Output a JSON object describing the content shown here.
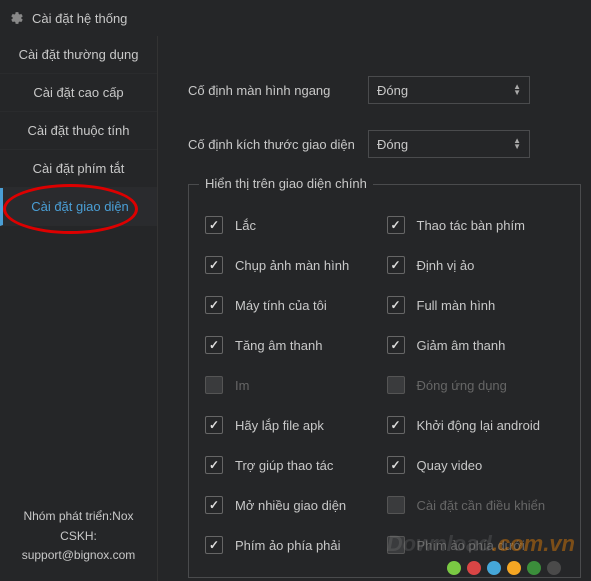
{
  "window": {
    "title": "Cài đặt hệ thống"
  },
  "sidebar": {
    "items": [
      {
        "label": "Cài đặt thường dụng"
      },
      {
        "label": "Cài đặt cao cấp"
      },
      {
        "label": "Cài đặt thuộc tính"
      },
      {
        "label": "Cài đặt phím tắt"
      },
      {
        "label": "Cài đặt giao diện"
      }
    ],
    "footer": {
      "line1": "Nhóm phát triển:Nox",
      "line2": "CSKH:",
      "line3": "support@bignox.com"
    }
  },
  "dropdowns": [
    {
      "label": "Cố định màn hình ngang",
      "value": "Đóng"
    },
    {
      "label": "Cố định kích thước giao diện",
      "value": "Đóng"
    }
  ],
  "fieldset": {
    "legend": "Hiển thị trên giao diện chính",
    "checkboxes": [
      {
        "label": "Lắc",
        "checked": true
      },
      {
        "label": "Thao tác bàn phím",
        "checked": true
      },
      {
        "label": "Chụp ảnh màn hình",
        "checked": true
      },
      {
        "label": "Định vị ảo",
        "checked": true
      },
      {
        "label": "Máy tính của tôi",
        "checked": true
      },
      {
        "label": "Full màn hình",
        "checked": true
      },
      {
        "label": "Tăng âm thanh",
        "checked": true
      },
      {
        "label": "Giảm âm thanh",
        "checked": true
      },
      {
        "label": "Im",
        "checked": false
      },
      {
        "label": "Đóng ứng dụng",
        "checked": false
      },
      {
        "label": "Hãy lắp file apk",
        "checked": true
      },
      {
        "label": "Khởi động lại android",
        "checked": true
      },
      {
        "label": "Trợ giúp thao tác",
        "checked": true
      },
      {
        "label": "Quay video",
        "checked": true
      },
      {
        "label": "Mở nhiều giao diện",
        "checked": true
      },
      {
        "label": "Cài đặt cần điều khiển",
        "checked": false
      },
      {
        "label": "Phím ảo phía phải",
        "checked": true
      },
      {
        "label": "Phím ảo phía dưới",
        "checked": false
      }
    ]
  },
  "watermark": {
    "text1": "Download",
    "text2": ".com.vn"
  },
  "dotColors": [
    "#7ac943",
    "#d94545",
    "#45a7d9",
    "#f5a623",
    "#3b8e3b",
    "#4a4a4a"
  ]
}
